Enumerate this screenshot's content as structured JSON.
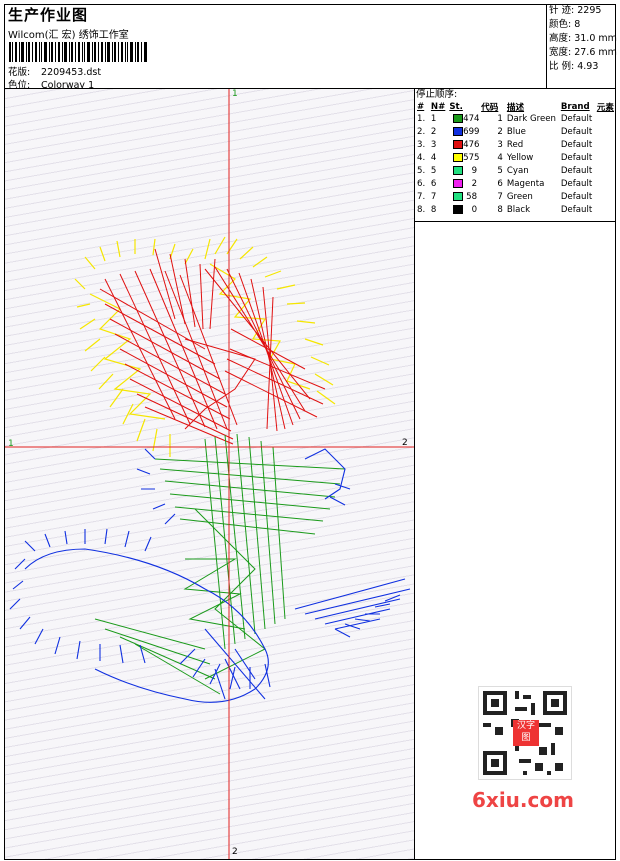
{
  "header": {
    "title": "生产作业图",
    "studio": "Wilcom(汇 宏) 绣饰工作室",
    "design_label": "花版:",
    "design_file": "2209453.dst",
    "colorway_label": "色位:",
    "colorway": "Colorway 1"
  },
  "stats": {
    "stitches": "针 迹: 2295",
    "colors": "颜色: 8",
    "height": "高度: 31.0 mm",
    "width": "宽度: 27.6 mm",
    "scale": "比 例: 4.93"
  },
  "stop_sequence": {
    "title": "停止顺序:",
    "headers": [
      "#",
      "N#",
      "St.",
      "代码",
      "描述",
      "Brand",
      "元素"
    ],
    "rows": [
      {
        "idx": "1.",
        "n": "1",
        "color": "#1a9a1a",
        "st": "474",
        "code": "1",
        "desc": "Dark Green",
        "brand": "Default"
      },
      {
        "idx": "2.",
        "n": "2",
        "color": "#1030e0",
        "st": "699",
        "code": "2",
        "desc": "Blue",
        "brand": "Default"
      },
      {
        "idx": "3.",
        "n": "3",
        "color": "#e01010",
        "st": "476",
        "code": "3",
        "desc": "Red",
        "brand": "Default"
      },
      {
        "idx": "4.",
        "n": "4",
        "color": "#ffff00",
        "st": "575",
        "code": "4",
        "desc": "Yellow",
        "brand": "Default"
      },
      {
        "idx": "5.",
        "n": "5",
        "color": "#20e080",
        "st": "9",
        "code": "5",
        "desc": "Cyan",
        "brand": "Default"
      },
      {
        "idx": "6.",
        "n": "6",
        "color": "#f020f0",
        "st": "2",
        "code": "6",
        "desc": "Magenta",
        "brand": "Default"
      },
      {
        "idx": "7.",
        "n": "7",
        "color": "#20e080",
        "st": "58",
        "code": "7",
        "desc": "Green",
        "brand": "Default"
      },
      {
        "idx": "8.",
        "n": "8",
        "color": "#000000",
        "st": "0",
        "code": "8",
        "desc": "Black",
        "brand": "Default"
      }
    ]
  },
  "axes": {
    "top_marker": "1",
    "bottom_marker": "2",
    "left_marker": "1",
    "right_marker": "2"
  },
  "watermark": {
    "text": "6xiu.com",
    "seal": "汉字图"
  }
}
